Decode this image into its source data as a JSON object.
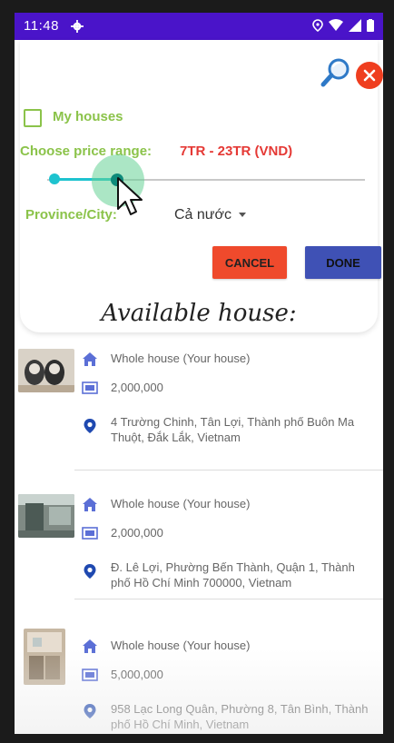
{
  "status_bar": {
    "time": "11:48"
  },
  "filter": {
    "my_houses_label": "My houses",
    "my_houses_checked": false,
    "price_label": "Choose price range:",
    "price_value": "7TR - 23TR (VND)",
    "province_label": "Province/City:",
    "province_value": "Cả nước",
    "cancel_label": "CANCEL",
    "done_label": "DONE"
  },
  "colors": {
    "status_bar": "#4a14c9",
    "label_green": "#8bc34a",
    "price_red": "#e53935",
    "cancel": "#ef4a2c",
    "done": "#3f51b5",
    "slider": "#1ec3cf"
  },
  "list": {
    "title": "Available house:",
    "items": [
      {
        "type": "Whole house (Your house)",
        "price": "2,000,000",
        "address": "4 Trường Chinh, Tân Lợi, Thành phố Buôn Ma Thuột, Đắk Lắk, Vietnam",
        "thumb": "dogs-photo"
      },
      {
        "type": "Whole house (Your house)",
        "price": "2,000,000",
        "address": "Đ. Lê Lợi, Phường Bến Thành, Quận 1, Thành phố Hồ Chí Minh 700000, Vietnam",
        "thumb": "room-photo"
      },
      {
        "type": "Whole house (Your house)",
        "price": "5,000,000",
        "address": "958 Lạc Long Quân, Phường 8, Tân Bình, Thành phố Hồ Chí Minh, Vietnam",
        "thumb": "kitchen-photo"
      }
    ]
  }
}
